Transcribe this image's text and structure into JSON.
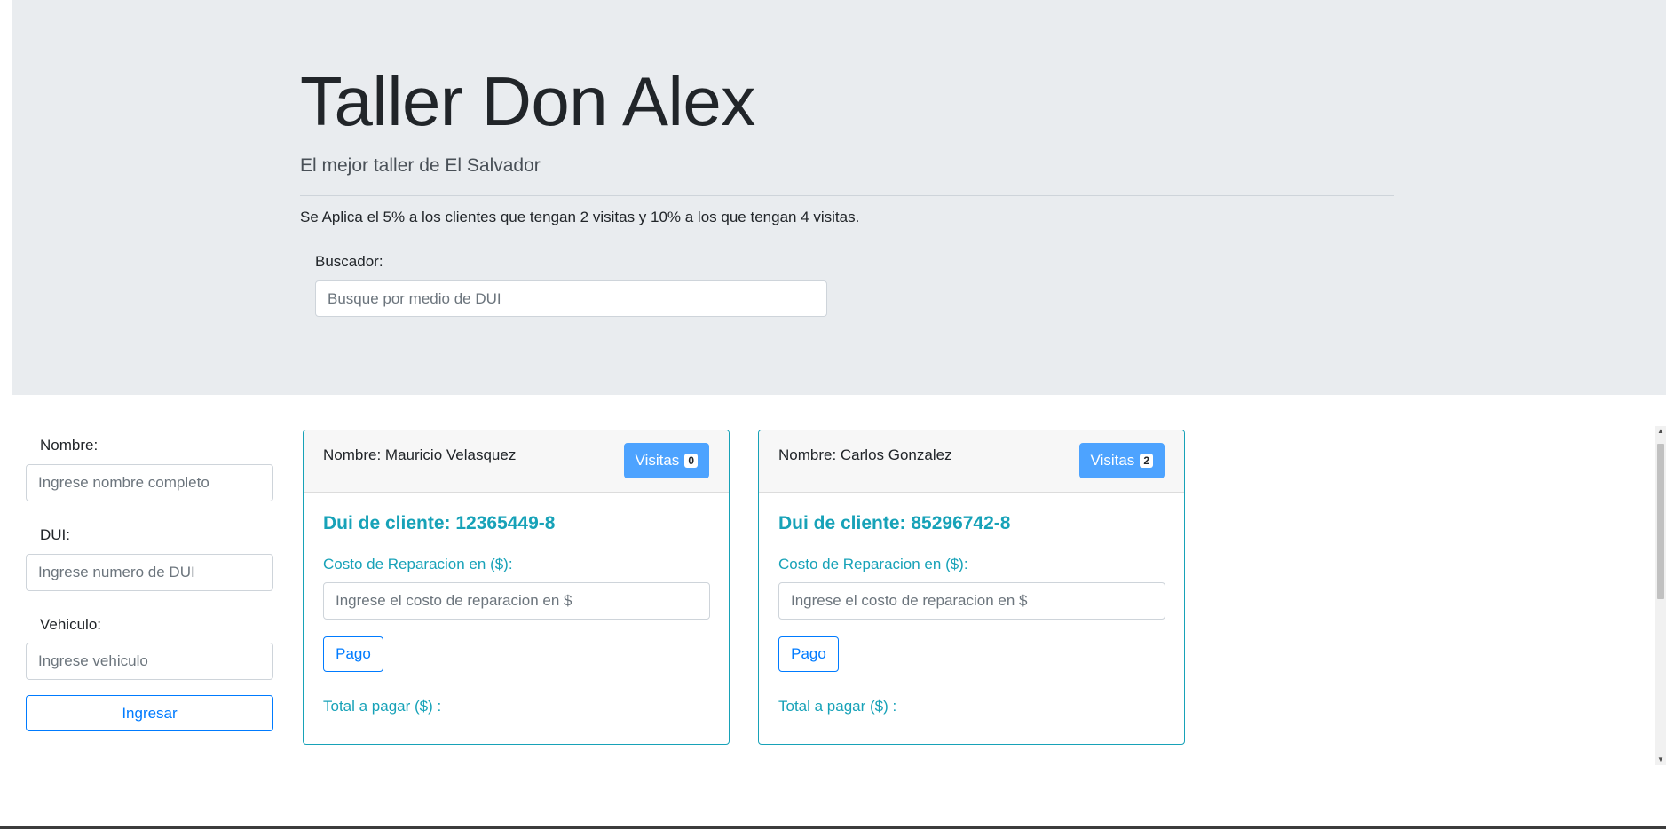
{
  "header": {
    "title": "Taller Don Alex",
    "subtitle": "El mejor taller de El Salvador",
    "note": "Se Aplica el 5% a los clientes que tengan 2 visitas y 10% a los que tengan 4 visitas.",
    "search_label": "Buscador:",
    "search_placeholder": "Busque por medio de DUI"
  },
  "form": {
    "name_label": "Nombre:",
    "name_placeholder": "Ingrese nombre completo",
    "dui_label": "DUI:",
    "dui_placeholder": "Ingrese numero de DUI",
    "vehicle_label": "Vehiculo:",
    "vehicle_placeholder": "Ingrese vehiculo",
    "submit_label": "Ingresar"
  },
  "cards": [
    {
      "name": "Nombre: Mauricio Velasquez",
      "visits_label": "Visitas",
      "visits_count": "0",
      "dui": "Dui de cliente: 12365449-8",
      "cost_label": "Costo de Reparacion en ($):",
      "cost_placeholder": "Ingrese el costo de reparacion en $",
      "pay_label": "Pago",
      "total_label": "Total a pagar ($) :"
    },
    {
      "name": "Nombre: Carlos Gonzalez",
      "visits_label": "Visitas",
      "visits_count": "2",
      "dui": "Dui de cliente: 85296742-8",
      "cost_label": "Costo de Reparacion en ($):",
      "cost_placeholder": "Ingrese el costo de reparacion en $",
      "pay_label": "Pago",
      "total_label": "Total a pagar ($) :"
    }
  ],
  "colors": {
    "jumbotron_bg": "#e9ecef",
    "primary": "#007bff",
    "info": "#17a2b8",
    "visits_button": "#4da3ff"
  }
}
